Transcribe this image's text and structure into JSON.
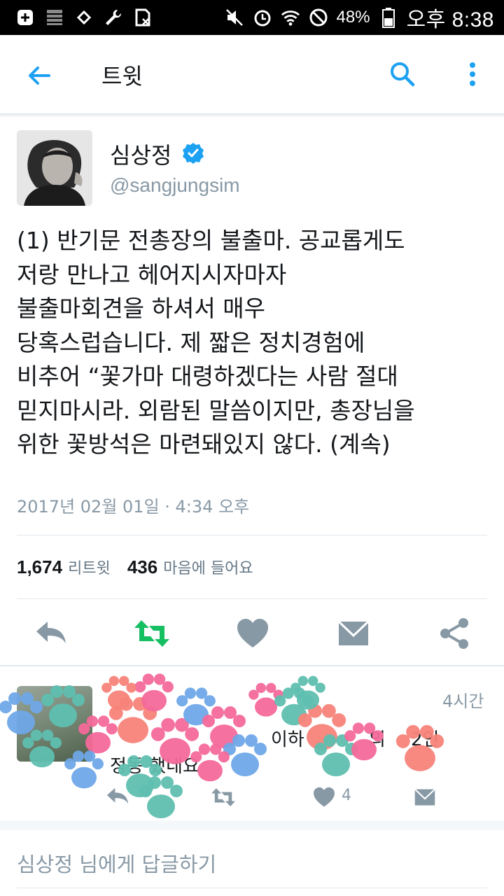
{
  "status_bar": {
    "battery": "48%",
    "time": "오후 8:38",
    "left_icons": [
      "add-icon",
      "storage-icon",
      "sim-icon",
      "wrench-icon",
      "sim-x-icon"
    ],
    "right_icons": [
      "mute-icon",
      "alarm-icon",
      "wifi-icon",
      "block-icon",
      "battery-icon"
    ]
  },
  "app_bar": {
    "title": "트윗"
  },
  "tweet": {
    "author_name": "심상정",
    "author_handle": "@sangjungsim",
    "verified": true,
    "text": "(1) 반기문 전총장의 불출마. 공교롭게도\n저랑 만나고 헤어지시자마자\n불출마회견을 하셔서 매우\n당혹스럽습니다. 제 짧은 정치경험에\n비추어 “꽃가마 대령하겠다는 사람 절대\n믿지마시라. 외람된 말씀이지만, 총장님을\n위한 꽃방석은 마련돼있지 않다. (계속)",
    "timestamp": "2017년 02월 01일 · 4:34 오후",
    "retweet_count": "1,674",
    "retweet_label": "리트윗",
    "like_count": "436",
    "like_label": "마음에 들어요"
  },
  "reply": {
    "time": "4시간",
    "text_fragments": [
      "이하",
      "의",
      "2인",
      "정동 했네요"
    ],
    "like_count": "4"
  },
  "reply_input": {
    "placeholder": "심상정 님에게 답글하기"
  },
  "colors": {
    "accent": "#1da1f2",
    "retweet_green": "#17bf63",
    "icon_gray": "#8899a6",
    "paw_blue": "#6fa8e8",
    "paw_pink": "#f56a9a",
    "paw_teal": "#5fbfb0",
    "paw_coral": "#f7837a"
  }
}
